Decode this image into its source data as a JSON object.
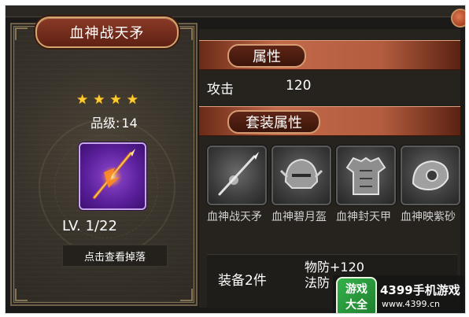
{
  "item": {
    "name": "血神战天矛",
    "stars": 4,
    "grade_label": "品级:",
    "grade_value": "14",
    "level": "LV. 1/22",
    "drop_button": "点击查看掉落"
  },
  "attributes": {
    "header": "属性",
    "stats": [
      {
        "name": "攻击",
        "value": "120"
      }
    ]
  },
  "set": {
    "header": "套装属性",
    "items": [
      {
        "name": "血神战天矛",
        "icon": "spear-icon"
      },
      {
        "name": "血神碧月盔",
        "icon": "helmet-icon"
      },
      {
        "name": "血神封天甲",
        "icon": "armor-icon"
      },
      {
        "name": "血神映紫砂",
        "icon": "shoulder-icon"
      }
    ],
    "bonus": {
      "label": "装备2件",
      "lines": [
        "物防+120",
        "法防"
      ]
    }
  },
  "watermark": {
    "logo_top": "游戏",
    "logo_bottom": "大全",
    "text": "4399手机游戏",
    "url": "www.4399.cn"
  },
  "colors": {
    "star": "#ffcc33",
    "item_quality": "#7a3ac0",
    "banner": "#c2694a"
  }
}
